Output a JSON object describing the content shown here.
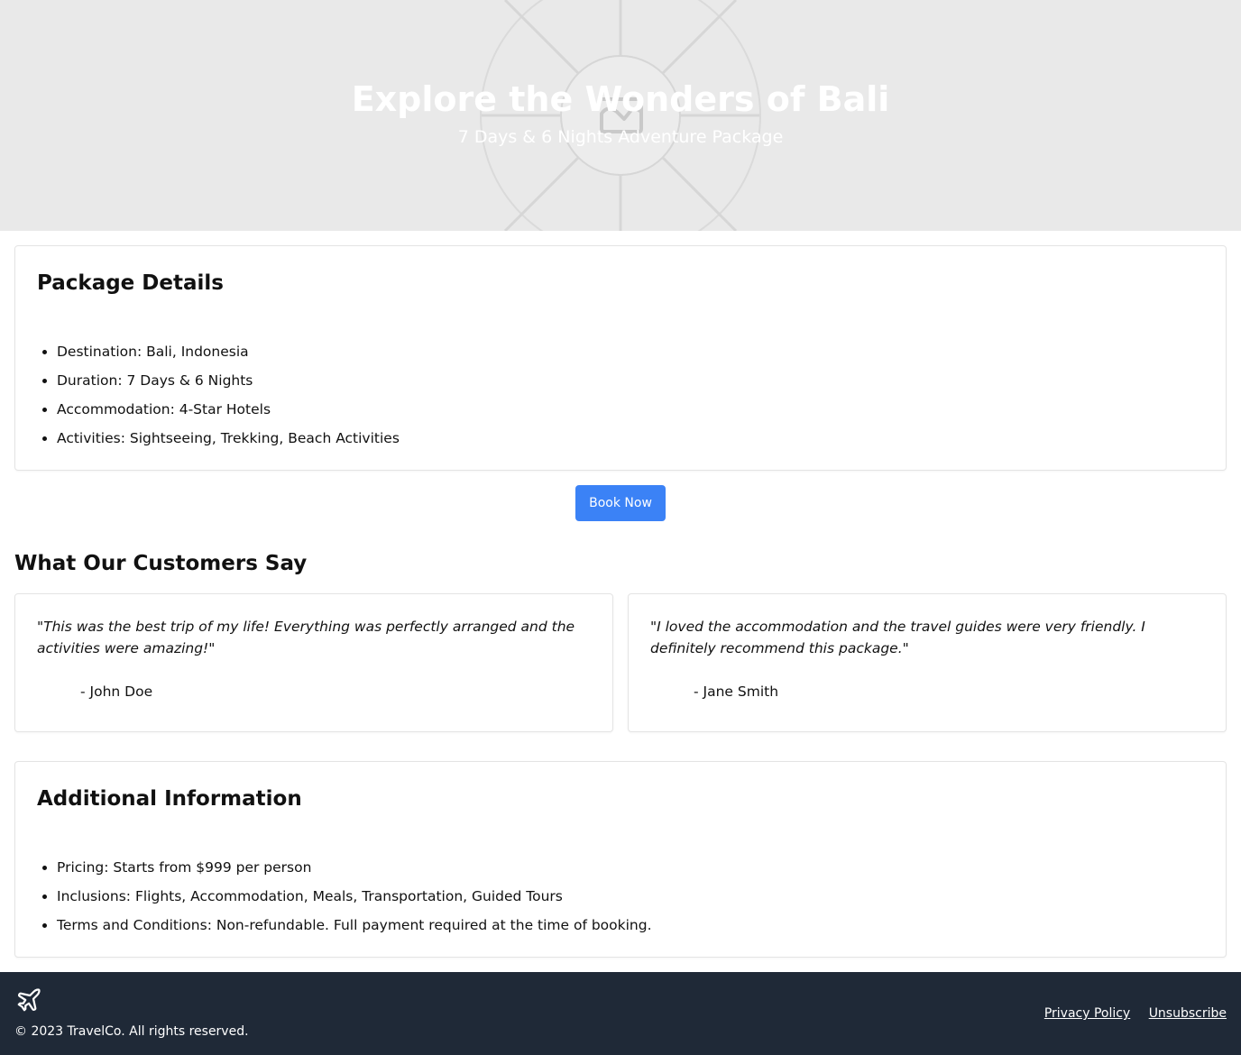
{
  "hero": {
    "title": "Explore the Wonders of Bali",
    "subtitle": "7 Days & 6 Nights Adventure Package",
    "image_icon": "image-placeholder-icon"
  },
  "package_details": {
    "heading": "Package Details",
    "items": [
      "Destination: Bali, Indonesia",
      "Duration: 7 Days & 6 Nights",
      "Accommodation: 4-Star Hotels",
      "Activities: Sightseeing, Trekking, Beach Activities"
    ]
  },
  "cta": {
    "book_label": "Book Now",
    "color": "#3b82f6"
  },
  "testimonials": {
    "heading": "What Our Customers Say",
    "items": [
      {
        "quote": "\"This was the best trip of my life! Everything was perfectly arranged and the activities were amazing!\"",
        "author": "- John Doe"
      },
      {
        "quote": "\"I loved the accommodation and the travel guides were very friendly. I definitely recommend this package.\"",
        "author": "- Jane Smith"
      }
    ]
  },
  "additional_info": {
    "heading": "Additional Information",
    "items": [
      "Pricing: Starts from $999 per person",
      "Inclusions: Flights, Accommodation, Meals, Transportation, Guided Tours",
      "Terms and Conditions: Non-refundable. Full payment required at the time of booking."
    ]
  },
  "footer": {
    "logo_icon": "airplane-icon",
    "copyright": "© 2023 TravelCo. All rights reserved.",
    "links": {
      "privacy": "Privacy Policy",
      "unsubscribe": "Unsubscribe"
    },
    "background": "#1f2937"
  }
}
